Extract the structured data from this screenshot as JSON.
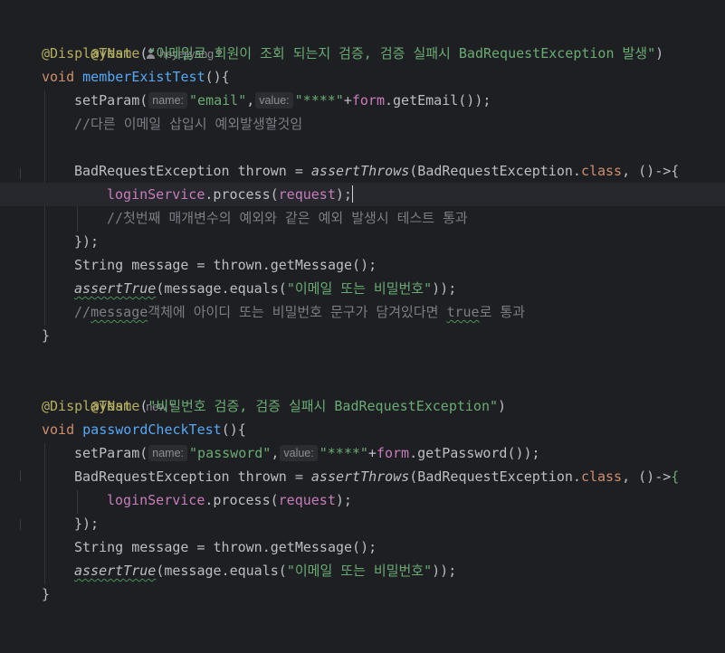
{
  "test1": {
    "annotation": "@Test",
    "author": "heyejiyang *",
    "display_annotation": "@DisplayName",
    "display_open": "(",
    "display_text": "\"이메일로 회원이 조회 되는지 검증, 검증 실패시 BadRequestException 발생\"",
    "display_close": ")",
    "return_type": "void",
    "method_name": "memberExistTest",
    "method_open": "(){",
    "setparam_fn": "setParam(",
    "hint_name": "name:",
    "param_name_str": "\"email\"",
    "comma": ",",
    "hint_value": "value:",
    "param_value_str": "\"****\"",
    "plus": "+",
    "form_field": "form",
    "getter_call": ".getEmail());",
    "comment1": "//다른 이메일 삽입시 예외발생할것임",
    "exception_type": "BadRequestException thrown = ",
    "assert_throws": "assertThrows",
    "assert_throws_args": "(BadRequestException.",
    "class_kw": "class",
    "lambda": ", ()->{",
    "login_service": "loginService",
    "process_call": ".process(",
    "request_field": "request",
    "process_end": ");",
    "comment2": "//첫번째 매개변수의 예외와 같은 예외 발생시 테스트 통과",
    "close_lambda": "});",
    "message_decl": "String message = thrown.getMessage();",
    "assert_true": "assertTrue",
    "equals_open": "(message.equals(",
    "equals_str": "\"이메일 또는 비밀번호\"",
    "equals_close": "));",
    "comment3_a": "//",
    "comment3_b": "message",
    "comment3_c": "객체에 아이디 또는 비밀번호 문구가 담겨있다면 ",
    "comment3_d": "true",
    "comment3_e": "로 통과",
    "close_method": "}"
  },
  "test2": {
    "annotation": "@Test",
    "author": "new *",
    "display_annotation": "@DisplayName",
    "display_open": "(",
    "display_text": "\"비밀번호 검증, 검증 실패시 BadRequestException\"",
    "display_close": ")",
    "return_type": "void",
    "method_name": "passwordCheckTest",
    "method_open": "(){",
    "setparam_fn": "setParam(",
    "hint_name": "name:",
    "param_name_str": "\"password\"",
    "comma": ",",
    "hint_value": "value:",
    "param_value_str": "\"****\"",
    "plus": "+",
    "form_field": "form",
    "getter_call": ".getPassword());",
    "exception_type": "BadRequestException thrown = ",
    "assert_throws": "assertThrows",
    "assert_throws_args": "(BadRequestException.",
    "class_kw": "class",
    "lambda": ", ()->",
    "lambda_brace": "{",
    "login_service": "loginService",
    "process_call": ".process(",
    "request_field": "request",
    "process_end": ");",
    "close_lambda": "});",
    "message_decl": "String message = thrown.getMessage();",
    "assert_true": "assertTrue",
    "equals_open": "(message.equals(",
    "equals_str": "\"이메일 또는 비밀번호\"",
    "equals_close": "));",
    "close_method": "}"
  },
  "colors": {
    "background": "#1e1f22",
    "current_line": "#26282e",
    "annotation": "#b3ae60",
    "keyword": "#cf8e6d",
    "function": "#56a8f5",
    "string": "#6aab73",
    "comment": "#7a7e85",
    "field": "#c77dbb",
    "default": "#bcbec4"
  }
}
